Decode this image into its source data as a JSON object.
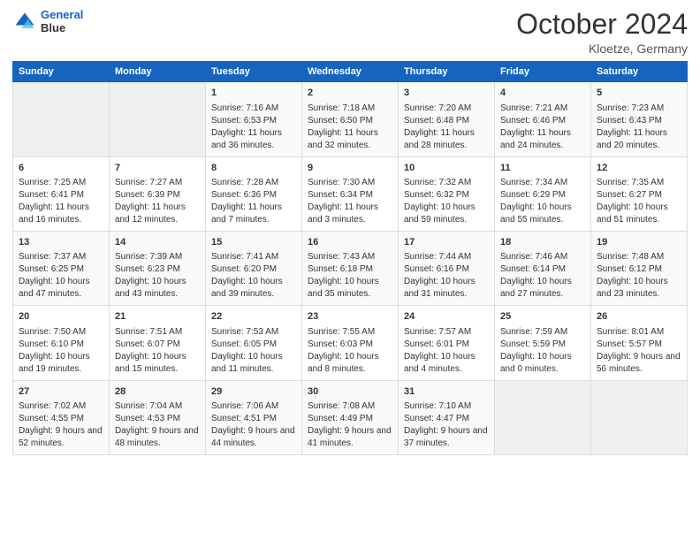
{
  "header": {
    "logo_line1": "General",
    "logo_line2": "Blue",
    "month": "October 2024",
    "location": "Kloetze, Germany"
  },
  "days_of_week": [
    "Sunday",
    "Monday",
    "Tuesday",
    "Wednesday",
    "Thursday",
    "Friday",
    "Saturday"
  ],
  "weeks": [
    [
      {
        "day": "",
        "sunrise": "",
        "sunset": "",
        "daylight": ""
      },
      {
        "day": "",
        "sunrise": "",
        "sunset": "",
        "daylight": ""
      },
      {
        "day": "1",
        "sunrise": "Sunrise: 7:16 AM",
        "sunset": "Sunset: 6:53 PM",
        "daylight": "Daylight: 11 hours and 36 minutes."
      },
      {
        "day": "2",
        "sunrise": "Sunrise: 7:18 AM",
        "sunset": "Sunset: 6:50 PM",
        "daylight": "Daylight: 11 hours and 32 minutes."
      },
      {
        "day": "3",
        "sunrise": "Sunrise: 7:20 AM",
        "sunset": "Sunset: 6:48 PM",
        "daylight": "Daylight: 11 hours and 28 minutes."
      },
      {
        "day": "4",
        "sunrise": "Sunrise: 7:21 AM",
        "sunset": "Sunset: 6:46 PM",
        "daylight": "Daylight: 11 hours and 24 minutes."
      },
      {
        "day": "5",
        "sunrise": "Sunrise: 7:23 AM",
        "sunset": "Sunset: 6:43 PM",
        "daylight": "Daylight: 11 hours and 20 minutes."
      }
    ],
    [
      {
        "day": "6",
        "sunrise": "Sunrise: 7:25 AM",
        "sunset": "Sunset: 6:41 PM",
        "daylight": "Daylight: 11 hours and 16 minutes."
      },
      {
        "day": "7",
        "sunrise": "Sunrise: 7:27 AM",
        "sunset": "Sunset: 6:39 PM",
        "daylight": "Daylight: 11 hours and 12 minutes."
      },
      {
        "day": "8",
        "sunrise": "Sunrise: 7:28 AM",
        "sunset": "Sunset: 6:36 PM",
        "daylight": "Daylight: 11 hours and 7 minutes."
      },
      {
        "day": "9",
        "sunrise": "Sunrise: 7:30 AM",
        "sunset": "Sunset: 6:34 PM",
        "daylight": "Daylight: 11 hours and 3 minutes."
      },
      {
        "day": "10",
        "sunrise": "Sunrise: 7:32 AM",
        "sunset": "Sunset: 6:32 PM",
        "daylight": "Daylight: 10 hours and 59 minutes."
      },
      {
        "day": "11",
        "sunrise": "Sunrise: 7:34 AM",
        "sunset": "Sunset: 6:29 PM",
        "daylight": "Daylight: 10 hours and 55 minutes."
      },
      {
        "day": "12",
        "sunrise": "Sunrise: 7:35 AM",
        "sunset": "Sunset: 6:27 PM",
        "daylight": "Daylight: 10 hours and 51 minutes."
      }
    ],
    [
      {
        "day": "13",
        "sunrise": "Sunrise: 7:37 AM",
        "sunset": "Sunset: 6:25 PM",
        "daylight": "Daylight: 10 hours and 47 minutes."
      },
      {
        "day": "14",
        "sunrise": "Sunrise: 7:39 AM",
        "sunset": "Sunset: 6:23 PM",
        "daylight": "Daylight: 10 hours and 43 minutes."
      },
      {
        "day": "15",
        "sunrise": "Sunrise: 7:41 AM",
        "sunset": "Sunset: 6:20 PM",
        "daylight": "Daylight: 10 hours and 39 minutes."
      },
      {
        "day": "16",
        "sunrise": "Sunrise: 7:43 AM",
        "sunset": "Sunset: 6:18 PM",
        "daylight": "Daylight: 10 hours and 35 minutes."
      },
      {
        "day": "17",
        "sunrise": "Sunrise: 7:44 AM",
        "sunset": "Sunset: 6:16 PM",
        "daylight": "Daylight: 10 hours and 31 minutes."
      },
      {
        "day": "18",
        "sunrise": "Sunrise: 7:46 AM",
        "sunset": "Sunset: 6:14 PM",
        "daylight": "Daylight: 10 hours and 27 minutes."
      },
      {
        "day": "19",
        "sunrise": "Sunrise: 7:48 AM",
        "sunset": "Sunset: 6:12 PM",
        "daylight": "Daylight: 10 hours and 23 minutes."
      }
    ],
    [
      {
        "day": "20",
        "sunrise": "Sunrise: 7:50 AM",
        "sunset": "Sunset: 6:10 PM",
        "daylight": "Daylight: 10 hours and 19 minutes."
      },
      {
        "day": "21",
        "sunrise": "Sunrise: 7:51 AM",
        "sunset": "Sunset: 6:07 PM",
        "daylight": "Daylight: 10 hours and 15 minutes."
      },
      {
        "day": "22",
        "sunrise": "Sunrise: 7:53 AM",
        "sunset": "Sunset: 6:05 PM",
        "daylight": "Daylight: 10 hours and 11 minutes."
      },
      {
        "day": "23",
        "sunrise": "Sunrise: 7:55 AM",
        "sunset": "Sunset: 6:03 PM",
        "daylight": "Daylight: 10 hours and 8 minutes."
      },
      {
        "day": "24",
        "sunrise": "Sunrise: 7:57 AM",
        "sunset": "Sunset: 6:01 PM",
        "daylight": "Daylight: 10 hours and 4 minutes."
      },
      {
        "day": "25",
        "sunrise": "Sunrise: 7:59 AM",
        "sunset": "Sunset: 5:59 PM",
        "daylight": "Daylight: 10 hours and 0 minutes."
      },
      {
        "day": "26",
        "sunrise": "Sunrise: 8:01 AM",
        "sunset": "Sunset: 5:57 PM",
        "daylight": "Daylight: 9 hours and 56 minutes."
      }
    ],
    [
      {
        "day": "27",
        "sunrise": "Sunrise: 7:02 AM",
        "sunset": "Sunset: 4:55 PM",
        "daylight": "Daylight: 9 hours and 52 minutes."
      },
      {
        "day": "28",
        "sunrise": "Sunrise: 7:04 AM",
        "sunset": "Sunset: 4:53 PM",
        "daylight": "Daylight: 9 hours and 48 minutes."
      },
      {
        "day": "29",
        "sunrise": "Sunrise: 7:06 AM",
        "sunset": "Sunset: 4:51 PM",
        "daylight": "Daylight: 9 hours and 44 minutes."
      },
      {
        "day": "30",
        "sunrise": "Sunrise: 7:08 AM",
        "sunset": "Sunset: 4:49 PM",
        "daylight": "Daylight: 9 hours and 41 minutes."
      },
      {
        "day": "31",
        "sunrise": "Sunrise: 7:10 AM",
        "sunset": "Sunset: 4:47 PM",
        "daylight": "Daylight: 9 hours and 37 minutes."
      },
      {
        "day": "",
        "sunrise": "",
        "sunset": "",
        "daylight": ""
      },
      {
        "day": "",
        "sunrise": "",
        "sunset": "",
        "daylight": ""
      }
    ]
  ]
}
